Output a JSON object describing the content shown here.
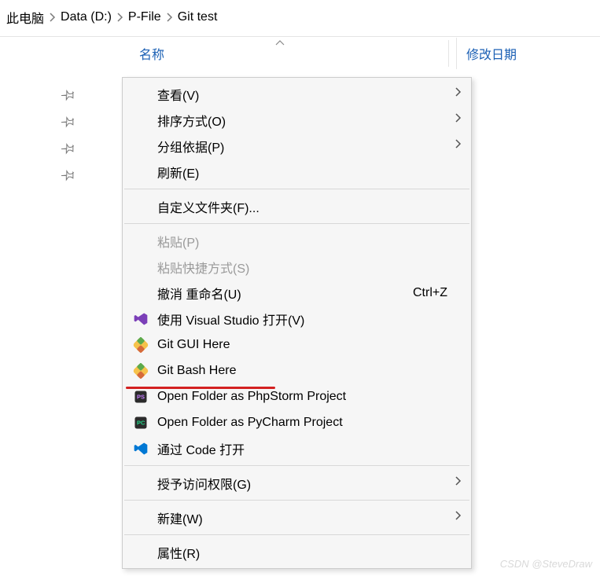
{
  "breadcrumb": {
    "items": [
      "此电脑",
      "Data (D:)",
      "P-File",
      "Git test"
    ]
  },
  "columns": {
    "name": "名称",
    "date": "修改日期"
  },
  "menu": {
    "view": "查看(V)",
    "sort": "排序方式(O)",
    "group": "分组依据(P)",
    "refresh": "刷新(E)",
    "customize": "自定义文件夹(F)...",
    "paste": "粘贴(P)",
    "paste_shortcut": "粘贴快捷方式(S)",
    "undo": "撤消 重命名(U)",
    "undo_key": "Ctrl+Z",
    "vs_open": "使用 Visual Studio 打开(V)",
    "git_gui": "Git GUI Here",
    "git_bash": "Git Bash Here",
    "phpstorm": "Open Folder as PhpStorm Project",
    "pycharm": "Open Folder as PyCharm Project",
    "code": "通过 Code 打开",
    "access": "授予访问权限(G)",
    "new": "新建(W)",
    "properties": "属性(R)"
  },
  "watermark": "CSDN @SteveDraw"
}
